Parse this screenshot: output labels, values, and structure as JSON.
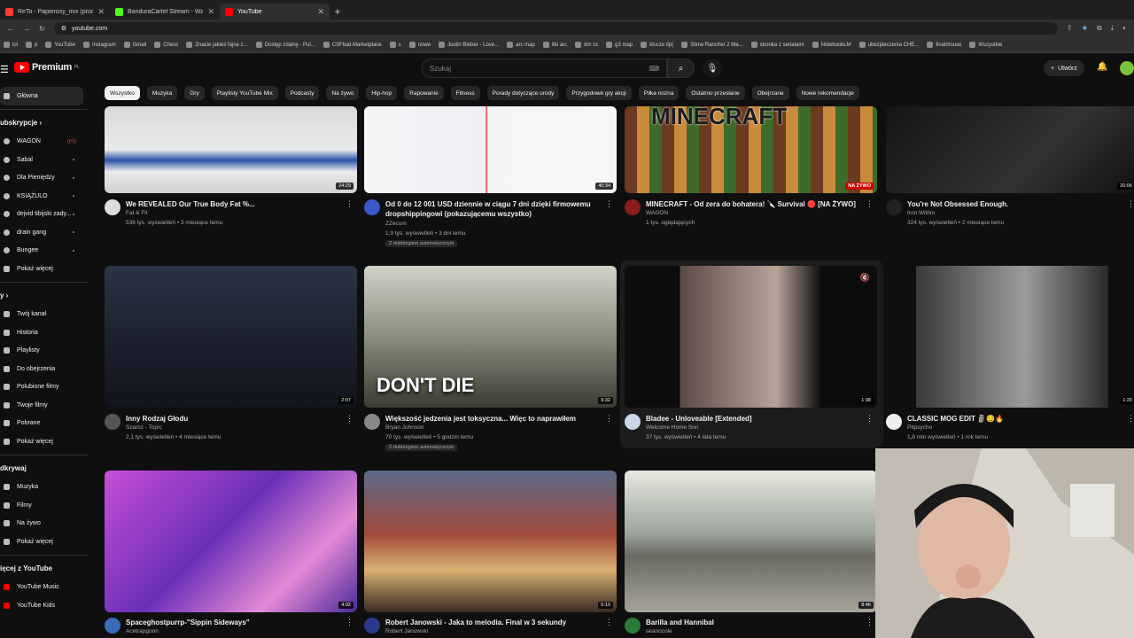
{
  "browser": {
    "tabs": [
      {
        "title": "ReTo - Papierosy_mix (prod. Sr",
        "color": "#ff3b30"
      },
      {
        "title": "BanduraCartel Stream - Watch",
        "color": "#53fc18"
      },
      {
        "title": "YouTube",
        "color": "#ff0000"
      }
    ],
    "url": "youtube.com",
    "bookmarks": [
      "lol",
      "p",
      "YouTube",
      "Instagram",
      "Gmail",
      "Chess",
      "Znacie jakieś fajne z...",
      "Dostęp zdalny - Pul...",
      "CSFloat Marketplace",
      "s",
      "nowe",
      "Justin Bieber - Love...",
      "arc map",
      "itki arc",
      "dm cs",
      "g3 map",
      "klucze itp(",
      "Slime Rancher 2 Ma...",
      "stronka z serialami",
      "NotebookLM",
      "ubezpieczenia CHE...",
      "finalmouse",
      "Wszystkie"
    ]
  },
  "header": {
    "logo": "Premium",
    "region": "PL",
    "search_placeholder": "Szukaj",
    "create_label": "Utwórz"
  },
  "sidebar": {
    "home": "Główna",
    "subs_title": "ubskrypcje",
    "subs": [
      {
        "label": "WAGON",
        "live": true
      },
      {
        "label": "Sabal"
      },
      {
        "label": "Dla Pieniędzy"
      },
      {
        "label": "KSIĄŻULO"
      },
      {
        "label": "dejvid tibijski zady..."
      },
      {
        "label": "drain gang"
      },
      {
        "label": "Bungee"
      }
    ],
    "subs_more": "Pokaż więcej",
    "you_title": "y",
    "you": [
      "Twój kanał",
      "Historia",
      "Playlisty",
      "Do obejrzenia",
      "Polubione filmy",
      "Twoje filmy",
      "Pobrane",
      "Pokaż więcej"
    ],
    "explore_title": "dkrywaj",
    "explore": [
      "Muzyka",
      "Filmy",
      "Na żywo",
      "Pokaż więcej"
    ],
    "more_title": "ięcej z YouTube",
    "more": [
      "YouTube Music",
      "YouTube Kids"
    ]
  },
  "chips": [
    "Wszystko",
    "Muzyka",
    "Gry",
    "Playlisty YouTube Mix",
    "Podcasty",
    "Na żywo",
    "Hip-hop",
    "Rapowanie",
    "Fitness",
    "Porady dotyczące urody",
    "Przygodowe gry akcji",
    "Piłka nożna",
    "Ostatnio przesłane",
    "Obejrzane",
    "Nowe rekomendacje"
  ],
  "videos": [
    {
      "title": "We REVEALED Our True Body Fat %...",
      "channel": "Fat & Fit",
      "stats": "536 tys. wyświetleń • 3 miesiące temu",
      "duration": "24:29"
    },
    {
      "title": "Od 0 do 12 001 USD dziennie w ciągu 7 dni dzięki firmowemu dropshippingowi (pokazującemu wszystko)",
      "channel": "ZZecom",
      "stats": "1,9 tys. wyświetleń • 3 dni temu",
      "duration": "40:34",
      "dub": "Z dubbingiem automatycznym"
    },
    {
      "title": "MINECRAFT - Od zera do bohatera! 🔪 Survival 🔴 [NA ŻYWO]",
      "channel": "WAGON",
      "stats": "1 tys. oglądających",
      "live_label": "NA ŻYWO",
      "thumb_text": "MINECRAFT"
    },
    {
      "title": "You're Not Obsessed Enough.",
      "channel": "Iron Within",
      "stats": "324 tys. wyświetleń • 2 miesiące temu",
      "duration": "20:06"
    },
    {
      "title": "Inny Rodzaj Głodu",
      "channel": "Szamz - Topic",
      "stats": "2,1 tys. wyświetleń • 4 miesiące temu",
      "duration": "2:07"
    },
    {
      "title": "Większość jedzenia jest toksyczna... Więc to naprawiłem",
      "channel": "Bryan Johnson",
      "stats": "70 tys. wyświetleń • 5 godzin temu",
      "duration": "9:32",
      "dub": "Z dubbingiem automatycznym",
      "thumb_text": "DON'T DIE"
    },
    {
      "title": "Bladee - Unloveable [Extended]",
      "channel": "Welcome Home Son",
      "stats": "37 tys. wyświetleń • 4 lata temu",
      "duration": "1:38"
    },
    {
      "title": "CLASSIC MOG EDIT 🗿😏🔥",
      "channel": "Pitpsycho",
      "stats": "1,8 mln wyświetleń • 1 rok temu",
      "duration": "1:20"
    },
    {
      "title": "Spaceghostpurrp-\"Sippin Sideways\"",
      "channel": "Acetrapgoon",
      "stats": "",
      "duration": "4:02"
    },
    {
      "title": "Robert Janowski - Jaka to melodia. Final w 3 sekundy",
      "channel": "Robert Janowski",
      "stats": "",
      "duration": "5:10"
    },
    {
      "title": "Barilla and Hannibal",
      "channel": "seanocole",
      "stats": "",
      "duration": "8:46"
    }
  ],
  "colors": {
    "bg": "#0f0f0f",
    "chip": "#272727",
    "accent": "#ff0000",
    "text": "#f1f1f1",
    "muted": "#aaaaaa"
  }
}
